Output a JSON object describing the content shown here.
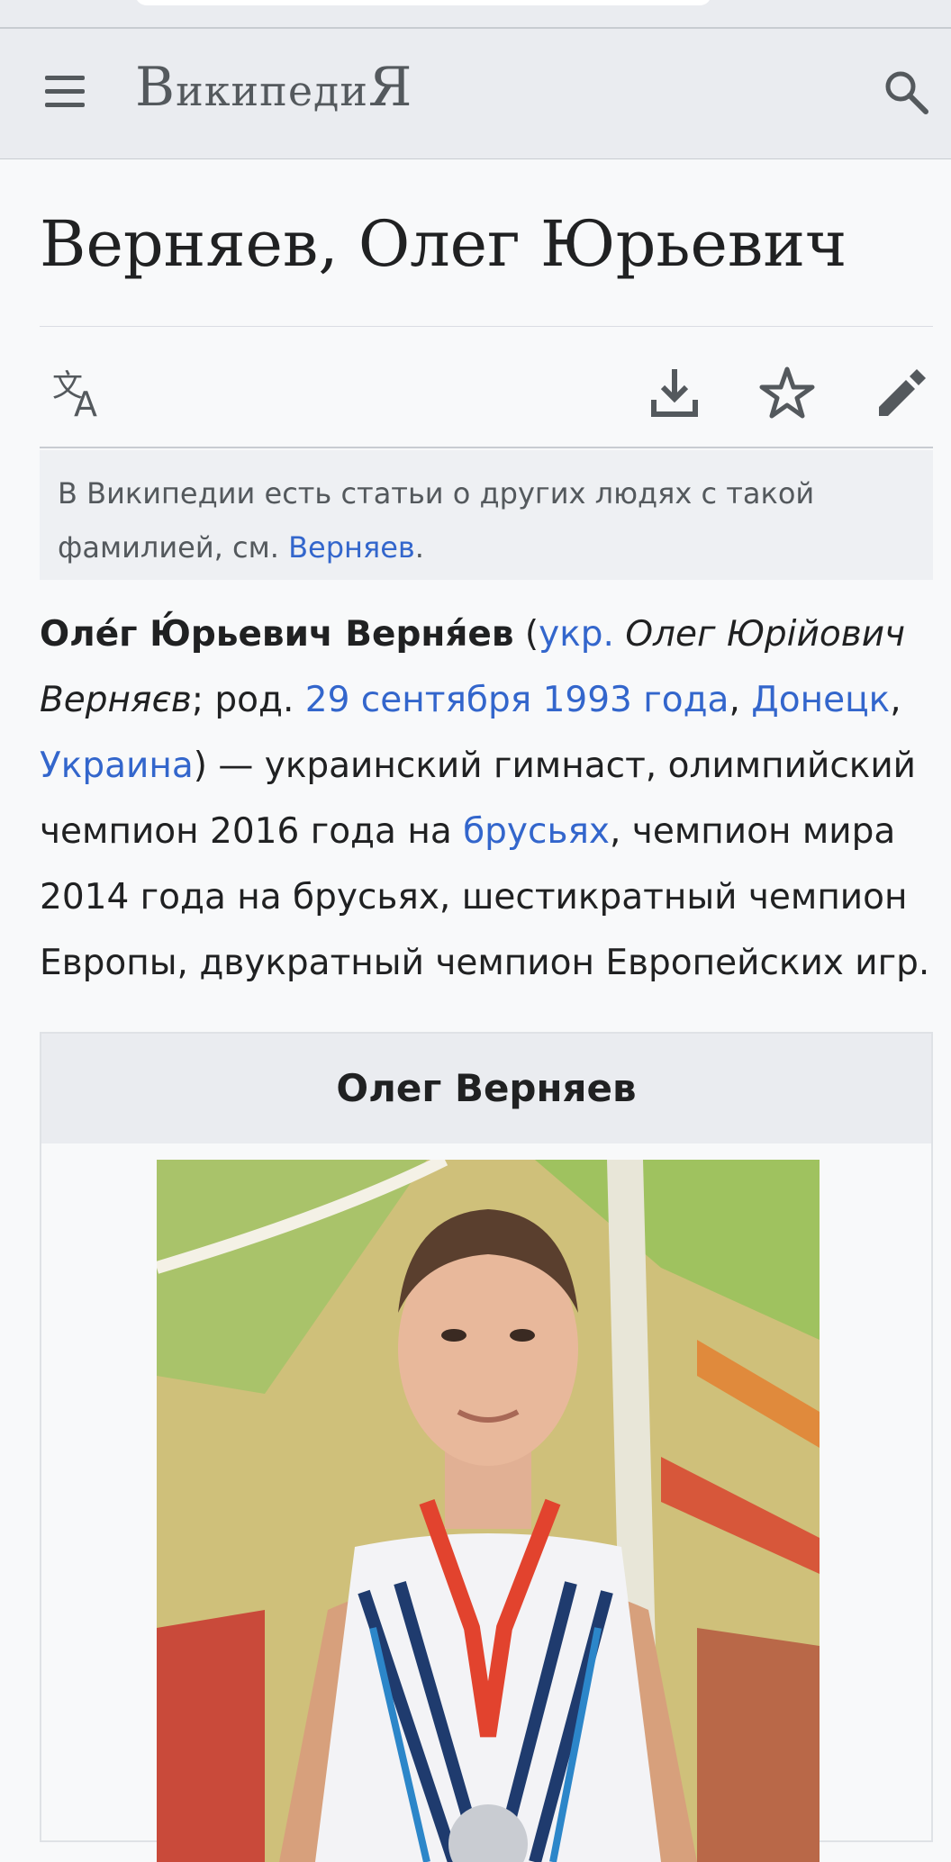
{
  "header": {
    "logo_part1": "В",
    "logo_part2": "икипеди",
    "logo_part3": "Я",
    "menu_icon": "hamburger-menu-icon",
    "search_icon": "search-icon"
  },
  "page": {
    "title": "Верняев, Олег Юрьевич"
  },
  "actions": {
    "language_icon": "translate-icon",
    "download_icon": "download-icon",
    "watch_icon": "star-icon",
    "edit_icon": "pencil-icon"
  },
  "hatnote": {
    "text_before": "В Википедии есть статьи о других людях с такой фамилией, см. ",
    "link": "Верняев",
    "text_after": "."
  },
  "lead": {
    "name_bold": "Оле́г Ю́рьевич Верня́ев",
    "paren_open": " (",
    "lang_link": "укр.",
    "native_name": " Олег Юрійович Верняєв",
    "born_text": "; род. ",
    "date_link": "29 сентября 1993 года",
    "comma1": ", ",
    "city_link": "Донецк",
    "comma2": ", ",
    "country_link": "Украина",
    "desc1": ") — украинский гимнаст, олимпийский чемпион 2016 года на ",
    "bars_link": "брусьях",
    "desc2": ", чемпион мира 2014 года на брусьях, шестикратный чемпион Европы, двукратный чемпион Европейских игр."
  },
  "infobox": {
    "title": "Олег Верняев"
  },
  "colors": {
    "link": "#3366cc",
    "header_bg": "#eaecf0",
    "page_bg": "#f8f9fa",
    "text": "#202122"
  }
}
